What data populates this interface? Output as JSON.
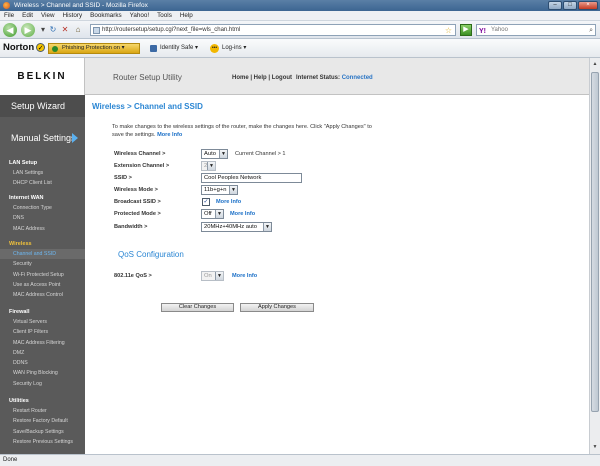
{
  "window": {
    "title": "Wireless > Channel and SSID - Mozilla Firefox"
  },
  "menu": [
    "File",
    "Edit",
    "View",
    "History",
    "Bookmarks",
    "Yahoo!",
    "Tools",
    "Help"
  ],
  "browser": {
    "url": "http://routersetup/setup.cgi?next_file=wls_chan.html",
    "search_placeholder": "Yahoo"
  },
  "norton": {
    "brand": "Norton",
    "phishing": "Phishing Protection on",
    "identity": "Identity Safe",
    "login": "Log-ins"
  },
  "router": {
    "brand": "BELKIN",
    "utility_title": "Router Setup Utility",
    "links": "Home | Help | Logout",
    "internet_status_label": "Internet Status:",
    "internet_status_value": "Connected"
  },
  "sidebar": {
    "setup_wizard": "Setup Wizard",
    "manual_settings": "Manual Settings",
    "groups": [
      {
        "title": "LAN Setup",
        "items": [
          "LAN Settings",
          "DHCP Client List"
        ]
      },
      {
        "title": "Internet WAN",
        "items": [
          "Connection Type",
          "DNS",
          "MAC Address"
        ]
      },
      {
        "title": "Wireless",
        "items": [
          "Channel and SSID",
          "Security",
          "Wi-Fi Protected Setup",
          "Use as Access Point",
          "MAC Address Control"
        ]
      },
      {
        "title": "Firewall",
        "items": [
          "Virtual Servers",
          "Client IP Filters",
          "MAC Address Filtering",
          "DMZ",
          "DDNS",
          "WAN Ping Blocking",
          "Security Log"
        ]
      },
      {
        "title": "Utilities",
        "items": [
          "Restart Router",
          "Restore Factory Default",
          "Save/Backup Settings",
          "Restore Previous Settings"
        ]
      }
    ]
  },
  "content": {
    "title": "Wireless > Channel and SSID",
    "intro": "To make changes to the wireless settings of the router, make the changes here. Click \"Apply Changes\" to save the settings.",
    "more_info": "More Info",
    "wireless_channel_label": "Wireless Channel >",
    "wireless_channel_value": "Auto",
    "current_channel": "Current Channel > 1",
    "extension_channel_label": "Extension Channel >",
    "extension_channel_value": "2",
    "ssid_label": "SSID >",
    "ssid_value": "Cool Peoples Network",
    "wireless_mode_label": "Wireless Mode >",
    "wireless_mode_value": "11b+g+n",
    "broadcast_ssid_label": "Broadcast SSID >",
    "broadcast_ssid_checked": "✓",
    "protected_mode_label": "Protected Mode >",
    "protected_mode_value": "Off",
    "bandwidth_label": "Bandwidth >",
    "bandwidth_value": "20MHz+40MHz auto",
    "qos_title": "QoS Configuration",
    "qos_label": "802.11e QoS >",
    "qos_value": "On",
    "clear_button": "Clear Changes",
    "apply_button": "Apply Changes"
  },
  "status": {
    "text": "Done"
  },
  "colors": {
    "accent": "#2b86d3",
    "link": "#1a6fc7",
    "sidebar": "#5a5a5a",
    "active_group": "#f0c13b"
  }
}
